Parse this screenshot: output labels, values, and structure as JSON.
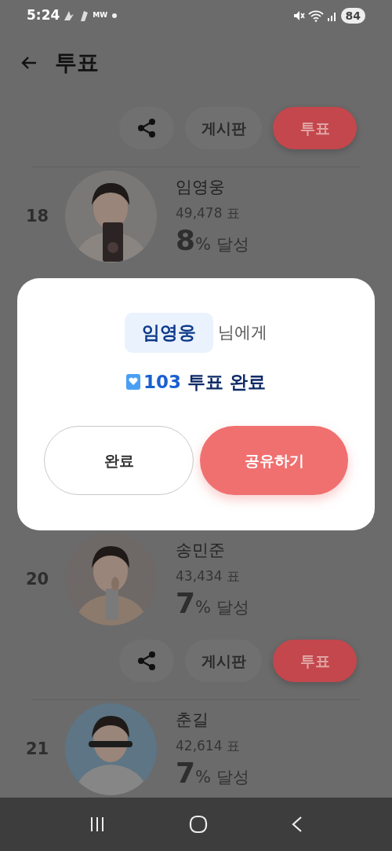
{
  "status_bar": {
    "time": "5:24",
    "notification_text": "MW",
    "battery": "84"
  },
  "header": {
    "title": "투표"
  },
  "list_above": [
    {
      "kind": "actions",
      "board_label": "게시판",
      "vote_label": "투표"
    },
    {
      "kind": "candidate",
      "rank": "18",
      "name": "임영웅",
      "votes": "49,478 표",
      "percent": "8",
      "percent_label": "% 달성"
    }
  ],
  "dialog": {
    "name": "임영웅",
    "name_suffix": "님에게",
    "count": "103",
    "result": "투표 완료",
    "buttons": [
      {
        "label": "완료",
        "kind": "secondary"
      },
      {
        "label": "공유하기",
        "kind": "primary"
      }
    ]
  },
  "list_below": [
    {
      "kind": "candidate",
      "rank": "20",
      "name": "송민준",
      "votes": "43,434 표",
      "percent": "7",
      "percent_label": "% 달성"
    },
    {
      "kind": "actions",
      "board_label": "게시판",
      "vote_label": "투표"
    },
    {
      "kind": "candidate",
      "rank": "21",
      "name": "춘길",
      "votes": "42,614 표",
      "percent": "7",
      "percent_label": "% 달성"
    }
  ]
}
